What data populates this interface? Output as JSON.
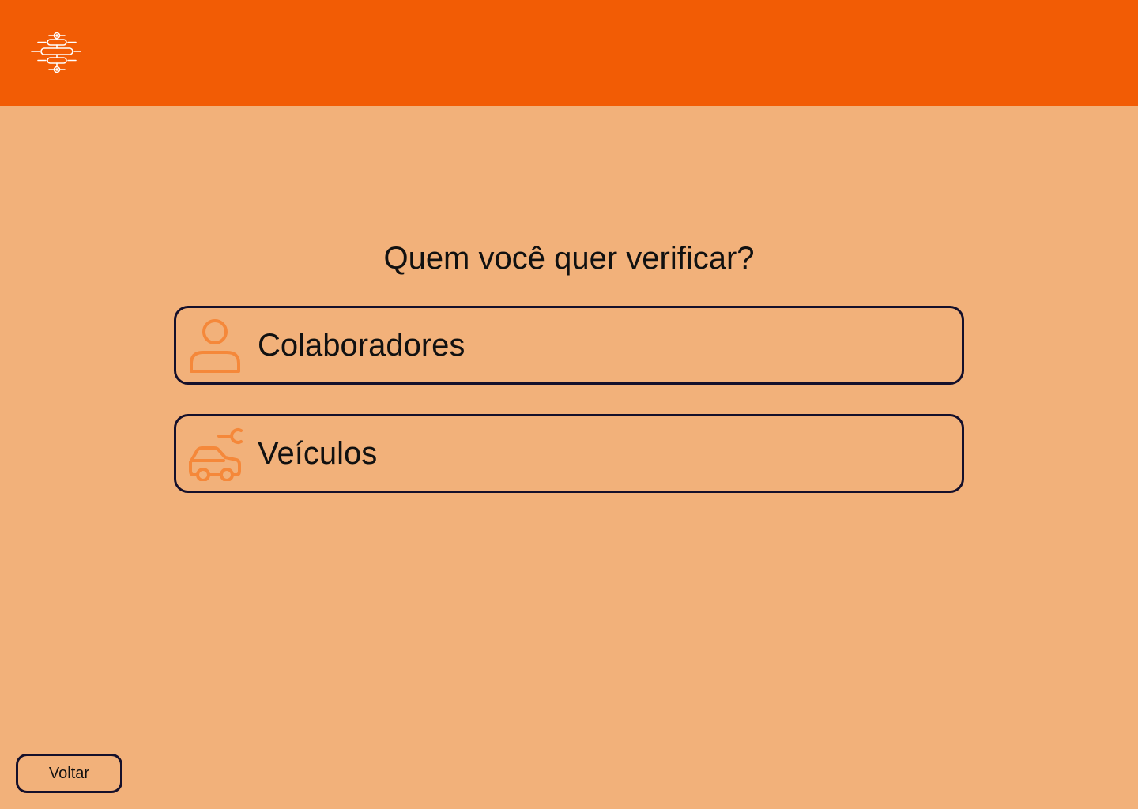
{
  "header": {
    "logo_icon": "circuit-logo-icon",
    "background_color": "#F25C05"
  },
  "main": {
    "question": "Quem você quer verificar?",
    "options": [
      {
        "label": "Colaboradores",
        "icon": "person-icon"
      },
      {
        "label": "Veículos",
        "icon": "car-wrench-icon"
      }
    ]
  },
  "footer": {
    "back_label": "Voltar"
  },
  "colors": {
    "page_background": "#F2B17A",
    "accent_icon": "#F5883A",
    "border": "#15102B"
  }
}
